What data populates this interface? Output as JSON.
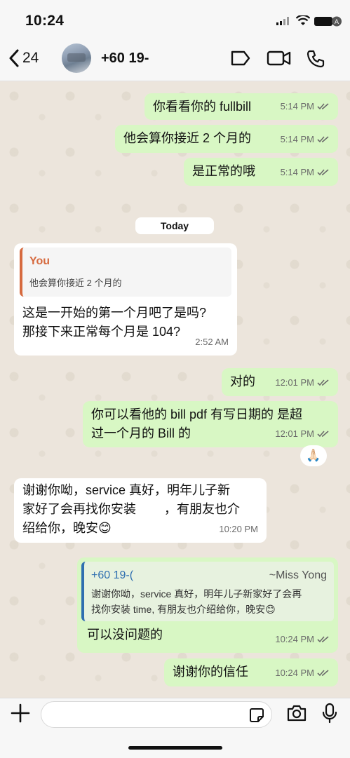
{
  "status_bar": {
    "time": "10:24"
  },
  "header": {
    "back_count": "24",
    "contact_name": "+60 19-"
  },
  "chat": {
    "day_separator": "Today",
    "messages": [
      {
        "text": "你看看你的 fullbill",
        "time": "5:14 PM"
      },
      {
        "text": "他会算你接近 2 个月的",
        "time": "5:14 PM"
      },
      {
        "text": "是正常的哦",
        "time": "5:14 PM"
      },
      {
        "quote_name": "You",
        "quote_text": "他会算你接近 2 个月的",
        "text_line1": "这是一开始的第一个月吧了是吗?",
        "text_line2": "那接下来正常每个月是 104?",
        "time": "2:52 AM"
      },
      {
        "text": "对的",
        "time": "12:01 PM"
      },
      {
        "text_line1": "你可以看他的 bill pdf 有写日期的 是超",
        "text_line2": "过一个月的 Bill 的",
        "time": "12:01 PM",
        "reaction": "🙏🏻"
      },
      {
        "text_line1": "谢谢你呦，service 真好，明年儿子新",
        "text_line2": "家好了会再找你安装        ，有朋友也介",
        "text_line3": "绍给你，晚安😊",
        "time": "10:20 PM"
      },
      {
        "quote_name": "+60 19-(",
        "quote_alias": "~Miss Yong",
        "quote_line1": "谢谢你呦，service 真好，明年儿子新家好了会再",
        "quote_line2": "找你安装 time, 有朋友也介绍给你，晚安😊",
        "text": "可以没问题的",
        "time": "10:24 PM"
      },
      {
        "text": "谢谢你的信任",
        "time": "10:24 PM"
      }
    ]
  },
  "composer": {
    "placeholder": ""
  },
  "colors": {
    "outgoing": "#d8f7c4",
    "incoming": "#ffffff",
    "read_ticks": "#6a6a6a",
    "quote_you": "#d66a3f",
    "quote_contact": "#2f6fb0"
  }
}
